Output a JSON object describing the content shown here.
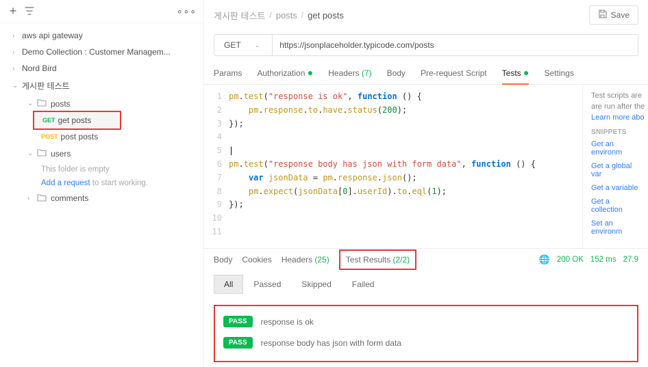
{
  "sidebar": {
    "collections": [
      {
        "label": "aws api gateway",
        "expanded": false
      },
      {
        "label": "Demo Collection : Customer Managem...",
        "expanded": false
      },
      {
        "label": "Nord Bird",
        "expanded": false
      },
      {
        "label": "게시판 테스트",
        "expanded": true,
        "folders": [
          {
            "label": "posts",
            "expanded": true,
            "items": [
              {
                "method": "GET",
                "label": "get posts",
                "active": true
              },
              {
                "method": "POST",
                "label": "post posts"
              }
            ]
          },
          {
            "label": "users",
            "expanded": true,
            "empty": true
          },
          {
            "label": "comments",
            "expanded": false
          }
        ]
      }
    ],
    "empty_msg": "This folder is empty",
    "add_request_link": "Add a request",
    "add_request_tail": " to start working."
  },
  "breadcrumb": [
    "게시판 테스트",
    "posts",
    "get posts"
  ],
  "save_label": "Save",
  "request": {
    "method": "GET",
    "url": "https://jsonplaceholder.typicode.com/posts"
  },
  "req_tabs": {
    "params": "Params",
    "auth": "Authorization",
    "headers": "Headers",
    "headers_count": "(7)",
    "body": "Body",
    "prereq": "Pre-request Script",
    "tests": "Tests",
    "settings": "Settings"
  },
  "editor_lines": [
    {
      "n": 1,
      "segs": [
        [
          "id",
          "pm"
        ],
        [
          "pl",
          "."
        ],
        [
          "id",
          "test"
        ],
        [
          "pl",
          "("
        ],
        [
          "str",
          "\"response is ok\""
        ],
        [
          "pl",
          ", "
        ],
        [
          "key",
          "function"
        ],
        [
          "pl",
          " () {"
        ]
      ]
    },
    {
      "n": 2,
      "segs": [
        [
          "pl",
          "    "
        ],
        [
          "id",
          "pm"
        ],
        [
          "pl",
          "."
        ],
        [
          "id",
          "response"
        ],
        [
          "pl",
          "."
        ],
        [
          "id",
          "to"
        ],
        [
          "pl",
          "."
        ],
        [
          "id",
          "have"
        ],
        [
          "pl",
          "."
        ],
        [
          "id",
          "status"
        ],
        [
          "pl",
          "("
        ],
        [
          "num",
          "200"
        ],
        [
          "pl",
          ");"
        ]
      ]
    },
    {
      "n": 3,
      "segs": [
        [
          "pl",
          "});"
        ]
      ]
    },
    {
      "n": 4,
      "segs": []
    },
    {
      "n": 5,
      "segs": [],
      "cursor": true
    },
    {
      "n": 6,
      "segs": [
        [
          "id",
          "pm"
        ],
        [
          "pl",
          "."
        ],
        [
          "id",
          "test"
        ],
        [
          "pl",
          "("
        ],
        [
          "str",
          "\"response body has json with form data\""
        ],
        [
          "pl",
          ", "
        ],
        [
          "key",
          "function"
        ],
        [
          "pl",
          " () {"
        ]
      ]
    },
    {
      "n": 7,
      "segs": [
        [
          "pl",
          "    "
        ],
        [
          "key",
          "var"
        ],
        [
          "pl",
          " "
        ],
        [
          "id",
          "jsonData"
        ],
        [
          "pl",
          " = "
        ],
        [
          "id",
          "pm"
        ],
        [
          "pl",
          "."
        ],
        [
          "id",
          "response"
        ],
        [
          "pl",
          "."
        ],
        [
          "id",
          "json"
        ],
        [
          "pl",
          "();"
        ]
      ]
    },
    {
      "n": 8,
      "segs": [
        [
          "pl",
          "    "
        ],
        [
          "id",
          "pm"
        ],
        [
          "pl",
          "."
        ],
        [
          "id",
          "expect"
        ],
        [
          "pl",
          "("
        ],
        [
          "id",
          "jsonData"
        ],
        [
          "pl",
          "["
        ],
        [
          "num",
          "0"
        ],
        [
          "pl",
          "]."
        ],
        [
          "id",
          "userId"
        ],
        [
          "pl",
          ")."
        ],
        [
          "id",
          "to"
        ],
        [
          "pl",
          "."
        ],
        [
          "id",
          "eql"
        ],
        [
          "pl",
          "("
        ],
        [
          "num",
          "1"
        ],
        [
          "pl",
          ");"
        ]
      ]
    },
    {
      "n": 9,
      "segs": [
        [
          "pl",
          "});"
        ]
      ]
    },
    {
      "n": 10,
      "segs": []
    },
    {
      "n": 11,
      "segs": []
    }
  ],
  "side_info": {
    "l1": "Test scripts are",
    "l2": "are run after the",
    "learn": "Learn more abo",
    "snip_hd": "SNIPPETS",
    "snips": [
      "Get an environm",
      "Get a global var",
      "Get a variable",
      "Get a collection",
      "Set an environm"
    ]
  },
  "res_tabs": {
    "body": "Body",
    "cookies": "Cookies",
    "headers": "Headers",
    "headers_count": "(25)",
    "results": "Test Results",
    "results_count": "(2/2)"
  },
  "status": {
    "code": "200 OK",
    "time": "152 ms",
    "size": "27.9"
  },
  "filters": {
    "all": "All",
    "passed": "Passed",
    "skipped": "Skipped",
    "failed": "Failed"
  },
  "test_results": [
    {
      "badge": "PASS",
      "text": "response is ok"
    },
    {
      "badge": "PASS",
      "text": "response body has json with form data"
    }
  ]
}
